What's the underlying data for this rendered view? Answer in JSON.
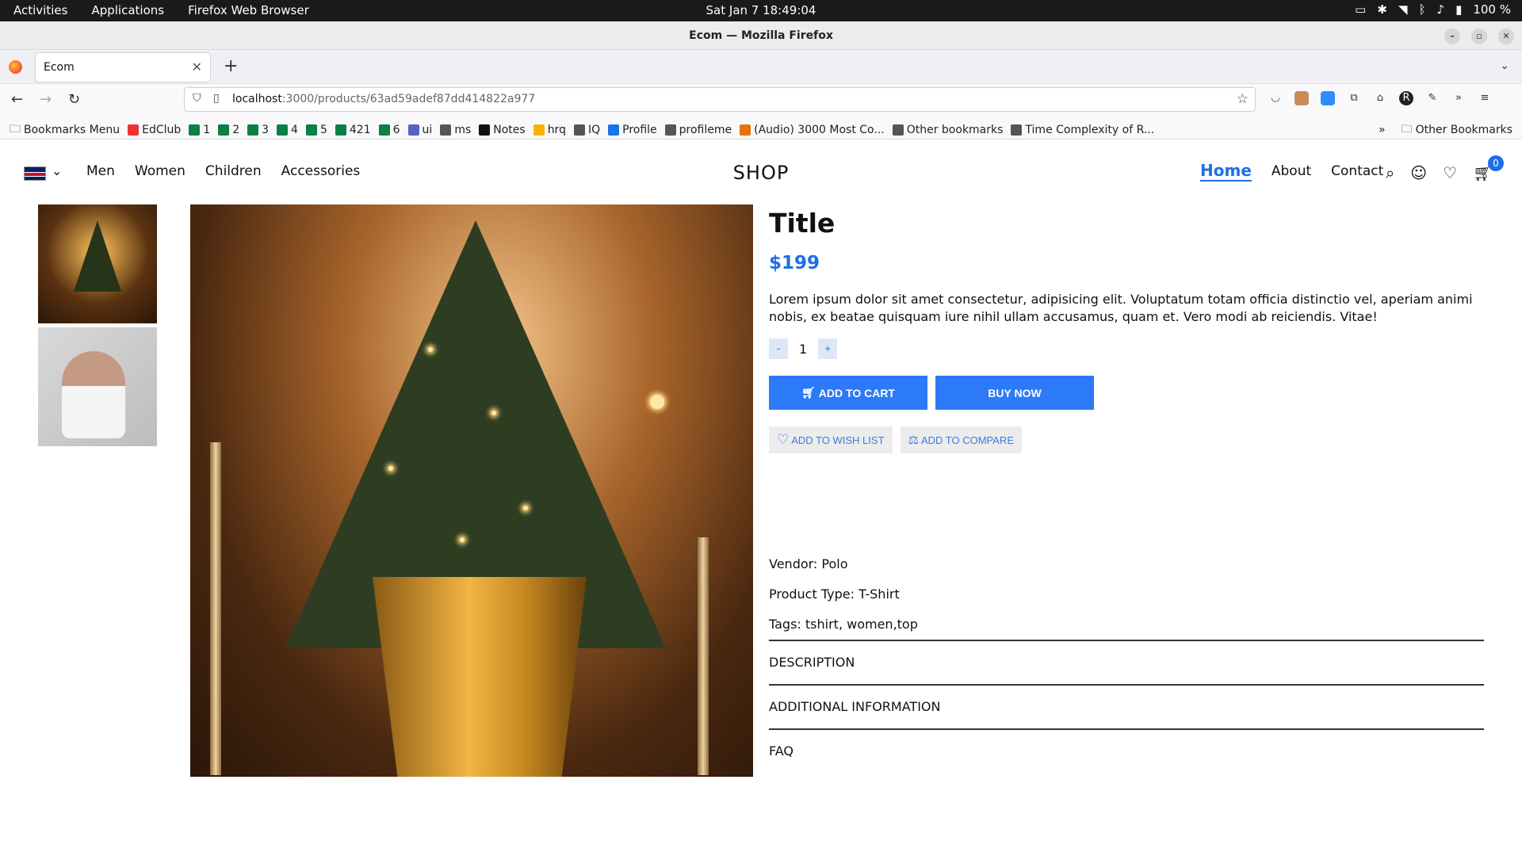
{
  "system": {
    "activities": "Activities",
    "applications": "Applications",
    "app_name": "Firefox Web Browser",
    "clock": "Sat Jan 7  18:49:04",
    "battery": "100 %"
  },
  "window": {
    "title": "Ecom — Mozilla Firefox"
  },
  "tab": {
    "title": "Ecom"
  },
  "url": {
    "host": "localhost",
    "path": ":3000/products/63ad59adef87dd414822a977"
  },
  "bookmarks": {
    "menu": "Bookmarks Menu",
    "items": [
      "EdClub",
      "1",
      "2",
      "3",
      "4",
      "5",
      "421",
      "6",
      "ui",
      "ms",
      "Notes",
      "hrq",
      "IQ",
      "Profile",
      "profileme",
      "(Audio) 3000 Most Co...",
      "Other bookmarks",
      "Time Complexity of R..."
    ],
    "other": "Other Bookmarks"
  },
  "site": {
    "logo": "SHOP",
    "nav": [
      "Men",
      "Women",
      "Children",
      "Accessories"
    ],
    "right_nav": [
      "Home",
      "About",
      "Contact"
    ],
    "cart_count": "0"
  },
  "product": {
    "title": "Title",
    "price": "$199",
    "description": "Lorem ipsum dolor sit amet consectetur, adipisicing elit. Voluptatum totam officia distinctio vel, aperiam animi nobis, ex beatae quisquam iure nihil ullam accusamus, quam et. Vero modi ab reiciendis. Vitae!",
    "qty_minus": "-",
    "qty": "1",
    "qty_plus": "+",
    "add_to_cart": "ADD TO CART",
    "buy_now": "BUY NOW",
    "wish": "ADD TO WISH LIST",
    "compare": "ADD TO COMPARE",
    "vendor": "Vendor: Polo",
    "type": "Product Type: T-Shirt",
    "tags": "Tags: tshirt, women,top",
    "sections": [
      "DESCRIPTION",
      "ADDITIONAL INFORMATION",
      "FAQ"
    ]
  }
}
